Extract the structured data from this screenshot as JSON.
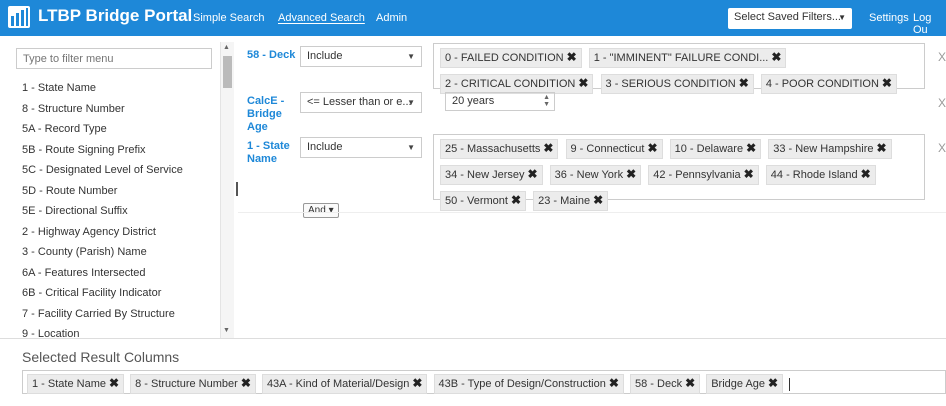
{
  "app": {
    "title": "LTBP Bridge Portal"
  },
  "nav": {
    "simple": "Simple Search",
    "advanced": "Advanced Search",
    "admin": "Admin",
    "saved_filters": "Select Saved Filters...",
    "settings": "Settings",
    "logout": "Log Ou"
  },
  "menu": {
    "filter_placeholder": "Type to filter menu",
    "items": [
      "1 - State Name",
      "8 - Structure Number",
      "5A - Record Type",
      "5B - Route Signing Prefix",
      "5C - Designated Level of Service",
      "5D - Route Number",
      "5E - Directional Suffix",
      "2 - Highway Agency District",
      "3 - County (Parish) Name",
      "6A - Features Intersected",
      "6B - Critical Facility Indicator",
      "7 - Facility Carried By Structure",
      "9 - Location"
    ]
  },
  "filters": [
    {
      "label": "58 - Deck",
      "operator": "Include",
      "tags": [
        "0 - FAILED CONDITION",
        "1 - \"IMMINENT\" FAILURE CONDI...",
        "2 - CRITICAL CONDITION",
        "3 - SERIOUS CONDITION",
        "4 - POOR CONDITION"
      ]
    },
    {
      "label": "CalcE - Bridge Age",
      "operator": "<= Lesser than or e...",
      "value": "20 years"
    },
    {
      "label": "1 - State Name",
      "operator": "Include",
      "tags": [
        "25 - Massachusetts",
        "9 - Connecticut",
        "10 - Delaware",
        "33 - New Hampshire",
        "34 - New Jersey",
        "36 - New York",
        "42 - Pennsylvania",
        "44 - Rhode Island",
        "50 - Vermont",
        "23 - Maine"
      ]
    }
  ],
  "and_label": "And ▾",
  "remove_glyph": "X",
  "tag_remove_glyph": "✖",
  "result_columns": {
    "title": "Selected Result Columns",
    "tags": [
      "1 - State Name",
      "8 - Structure Number",
      "43A - Kind of Material/Design",
      "43B - Type of Design/Construction",
      "58 - Deck",
      "Bridge Age"
    ]
  },
  "colors": {
    "brand": "#1e88d8"
  }
}
